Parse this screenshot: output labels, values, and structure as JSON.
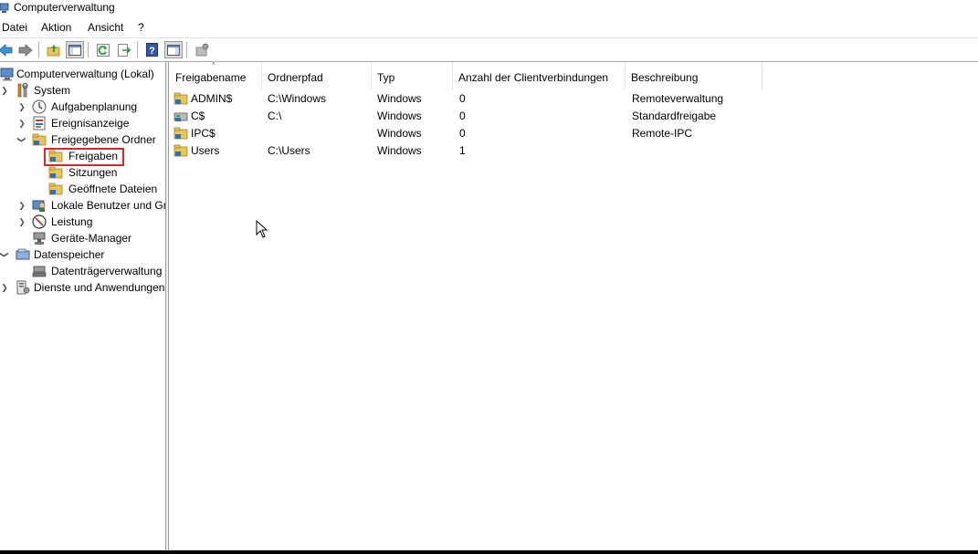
{
  "window": {
    "title": "Computerverwaltung"
  },
  "menu": [
    "Datei",
    "Aktion",
    "Ansicht",
    "?"
  ],
  "toolbar": {
    "buttons": [
      {
        "icon": "back-arrow-icon"
      },
      {
        "icon": "forward-arrow-icon"
      },
      {
        "icon": "up-folder-icon"
      },
      {
        "icon": "show-hide-console-tree-icon"
      },
      {
        "icon": "refresh-icon"
      },
      {
        "icon": "export-list-icon"
      },
      {
        "icon": "help-icon"
      },
      {
        "icon": "show-hide-action-pane-icon"
      },
      {
        "icon": "new-share-icon"
      }
    ]
  },
  "tree": {
    "items": [
      {
        "label": "Computerverwaltung (Lokal)",
        "icon": "computer-management-icon",
        "expander": ""
      },
      {
        "label": "System",
        "icon": "system-tools-icon",
        "expander": "expanded"
      },
      {
        "label": "Aufgabenplanung",
        "icon": "clock-icon",
        "expander": "collapsed"
      },
      {
        "label": "Ereignisanzeige",
        "icon": "event-viewer-icon",
        "expander": "collapsed"
      },
      {
        "label": "Freigegebene Ordner",
        "icon": "shared-folder-icon",
        "expander": "expanded"
      },
      {
        "label": "Freigaben",
        "icon": "shared-folder-icon",
        "expander": "",
        "selected": true
      },
      {
        "label": "Sitzungen",
        "icon": "shared-folder-icon",
        "expander": ""
      },
      {
        "label": "Geöffnete Dateien",
        "icon": "shared-folder-icon",
        "expander": ""
      },
      {
        "label": "Lokale Benutzer und Gr",
        "icon": "users-icon",
        "expander": "collapsed"
      },
      {
        "label": "Leistung",
        "icon": "performance-icon",
        "expander": "collapsed"
      },
      {
        "label": "Geräte-Manager",
        "icon": "device-manager-icon",
        "expander": ""
      },
      {
        "label": "Datenspeicher",
        "icon": "storage-icon",
        "expander": "expanded"
      },
      {
        "label": "Datenträgerverwaltung",
        "icon": "disk-management-icon",
        "expander": ""
      },
      {
        "label": "Dienste und Anwendungen",
        "icon": "services-icon",
        "expander": "collapsed"
      }
    ]
  },
  "list": {
    "columns": [
      "Freigabename",
      "Ordnerpfad",
      "Typ",
      "Anzahl der Clientverbindungen",
      "Beschreibung"
    ],
    "rows": [
      {
        "name": "ADMIN$",
        "path": "C:\\Windows",
        "type": "Windows",
        "connections": "0",
        "description": "Remoteverwaltung",
        "icon": "shared-folder-icon"
      },
      {
        "name": "C$",
        "path": "C:\\",
        "type": "Windows",
        "connections": "0",
        "description": "Standardfreigabe",
        "icon": "shared-drive-icon"
      },
      {
        "name": "IPC$",
        "path": "",
        "type": "Windows",
        "connections": "0",
        "description": "Remote-IPC",
        "icon": "shared-folder-icon"
      },
      {
        "name": "Users",
        "path": "C:\\Users",
        "type": "Windows",
        "connections": "1",
        "description": "",
        "icon": "shared-folder-icon"
      }
    ]
  },
  "colors": {
    "selection_outline": "#d9272e",
    "folder": "#e8c45a",
    "share_hand": "#2f6fb3"
  }
}
